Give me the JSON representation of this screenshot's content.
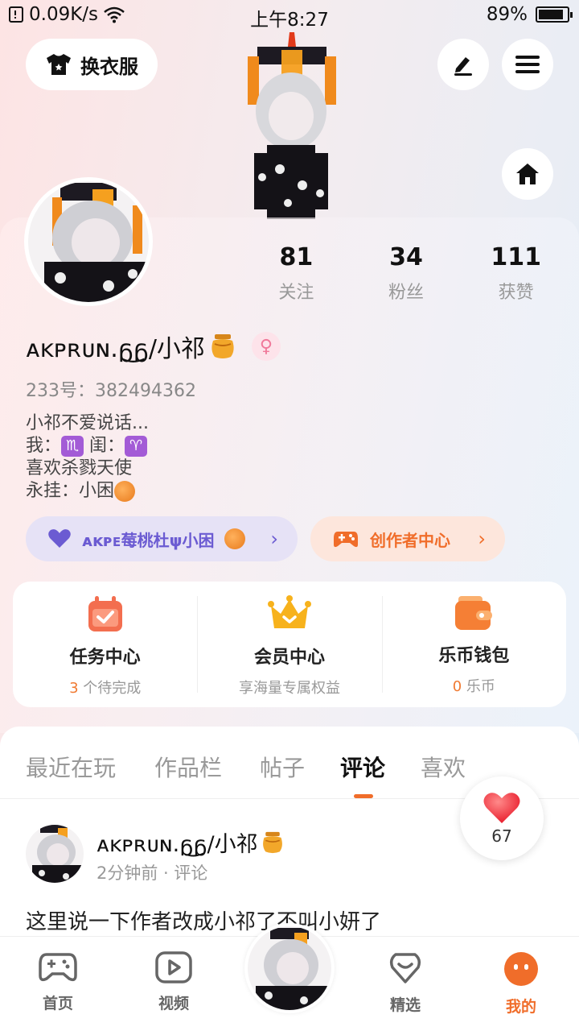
{
  "status_bar": {
    "speed": "0.09K/s",
    "time": "上午8:27",
    "battery": "89%",
    "battery_level": 0.89
  },
  "top": {
    "outfit_button": "换衣服",
    "icons": [
      "shirt-icon",
      "pen-icon",
      "menu-icon",
      "home-icon"
    ]
  },
  "stats": [
    {
      "num": "81",
      "label": "关注"
    },
    {
      "num": "34",
      "label": "粉丝"
    },
    {
      "num": "111",
      "label": "获赞"
    }
  ],
  "profile": {
    "username": "ᴀᴋᴘʀᴜɴ.ᵷ͜ᵷ/小祁",
    "uid": "233号：382494362",
    "bio_line1": "小祁不爱说话...",
    "bio_line2_a": "我：",
    "zodiac_me": "♏",
    "bio_line2_b": "闺：",
    "zodiac_bestie": "♈",
    "bio_line3": "喜欢杀戮天使",
    "bio_line4": "永挂：小困"
  },
  "chips": {
    "fan_group": "ᴀᴋᴘᴇ莓桃杜ψ小困",
    "creator": "创作者中心",
    "arrow": "›"
  },
  "services": [
    {
      "title": "任务中心",
      "sub_highlight": "3",
      "sub": " 个待完成"
    },
    {
      "title": "会员中心",
      "sub_highlight": "",
      "sub": "享海量专属权益"
    },
    {
      "title": "乐币钱包",
      "sub_highlight": "0",
      "sub": " 乐币"
    }
  ],
  "tabs": [
    "最近在玩",
    "作品栏",
    "帖子",
    "评论",
    "喜欢"
  ],
  "active_tab": "评论",
  "like_bubble": {
    "count": "67"
  },
  "post": {
    "user": "ᴀᴋᴘʀᴜɴ.ᵷ͜ᵷ/小祁",
    "meta": "2分钟前 · 评论",
    "text": "这里说一下作者改成小祁了不叫小妍了"
  },
  "nav": [
    {
      "label": "首页",
      "icon": "gamepad-icon"
    },
    {
      "label": "视频",
      "icon": "play-icon"
    },
    {
      "label": "精选",
      "icon": "heart-chat-icon"
    },
    {
      "label": "我的",
      "icon": "face-icon"
    }
  ],
  "colors": {
    "accent": "#f06d2a",
    "fan_chip": "#6b5bd2",
    "zodiac": "#a35bd6"
  }
}
